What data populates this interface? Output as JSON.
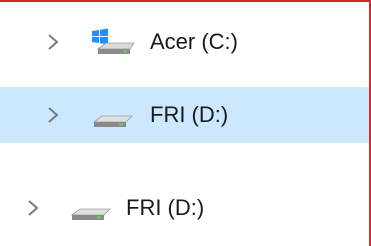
{
  "tree": {
    "items": [
      {
        "label": "Acer (C:)",
        "icon": "windows-drive-icon",
        "selected": false
      },
      {
        "label": "FRI (D:)",
        "icon": "drive-icon",
        "selected": true
      },
      {
        "label": "FRI (D:)",
        "icon": "drive-icon",
        "selected": false
      }
    ]
  },
  "colors": {
    "selection": "#cce8ff",
    "border": "#d9252b",
    "windows_logo": "#1e90ff"
  }
}
